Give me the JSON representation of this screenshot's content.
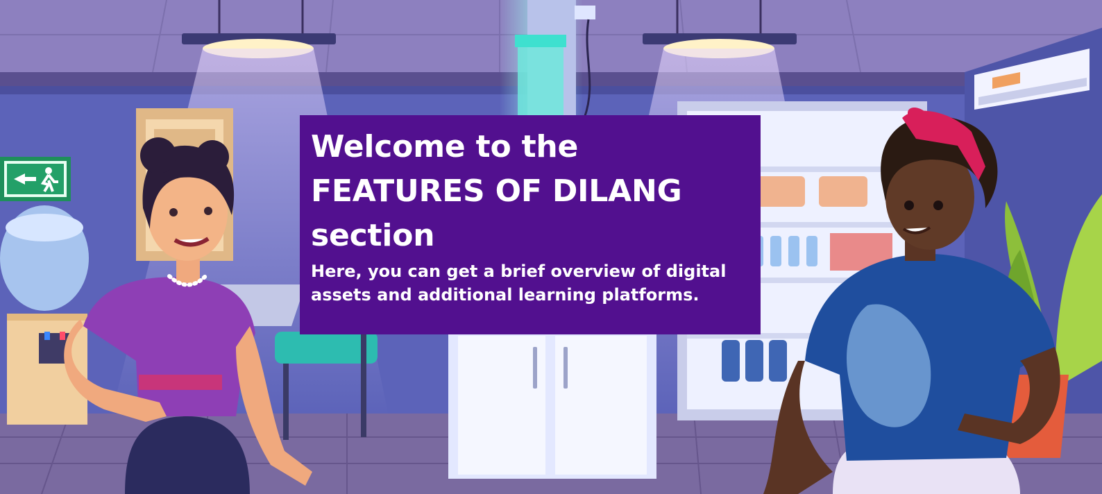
{
  "welcome": {
    "title_line1": "Welcome to the",
    "title_line2": "FEATURES OF DILANG",
    "title_line3": "section",
    "subtitle_line1": "Here, you can get a brief overview of digital",
    "subtitle_line2": "assets and additional learning platforms."
  },
  "colors": {
    "card_background": "#52108f",
    "card_text": "#ffffff",
    "wall": "#5c63b9",
    "ceiling": "#8c80bf",
    "floor": "#7a6aa0"
  },
  "scene": {
    "setting": "office-kitchen-illustration",
    "icons": [
      "emergency-exit-sign-icon",
      "water-cooler-icon",
      "ceiling-lamp-icon",
      "air-conditioner-icon",
      "refrigerator-icon",
      "plant-icon"
    ]
  }
}
